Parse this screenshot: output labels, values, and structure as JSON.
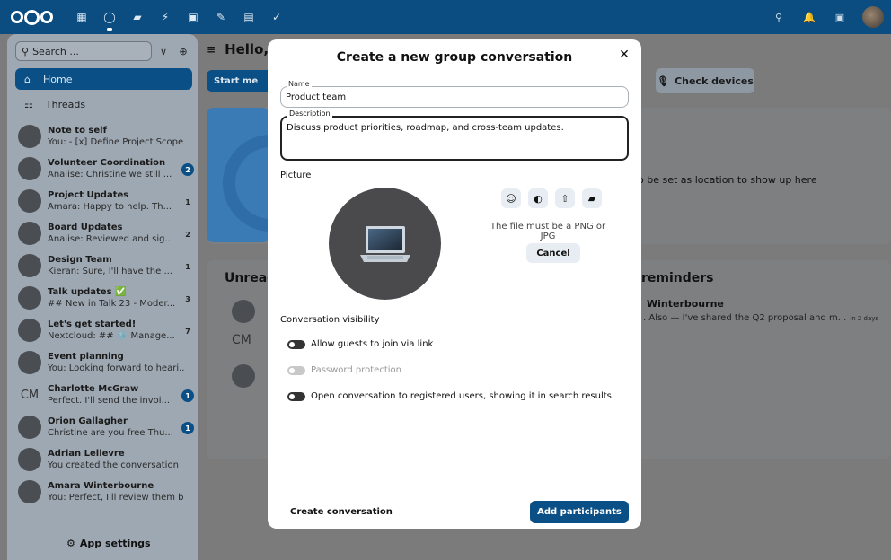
{
  "topbar": {
    "apps": [
      "dashboard-icon",
      "talk-icon",
      "files-icon",
      "activity-icon",
      "calendar-icon",
      "notes-icon",
      "deck-icon",
      "tasks-icon"
    ],
    "right": [
      "search-icon",
      "notifications-icon",
      "contacts-icon"
    ]
  },
  "sidebar": {
    "search_placeholder": "Search ...",
    "home_label": "Home",
    "threads_label": "Threads",
    "conversations": [
      {
        "name": "Note to self",
        "msg": "You: - [x] Define Project Scope ...",
        "badge": ""
      },
      {
        "name": "Volunteer Coordination",
        "msg": "Analise: Christine we still ...",
        "badge": "2",
        "badge_style": "blue"
      },
      {
        "name": "Project Updates",
        "msg": "Amara: Happy to help. Th...",
        "badge": "1",
        "badge_style": "plain"
      },
      {
        "name": "Board Updates",
        "msg": "Analise: Reviewed and sig...",
        "badge": "2",
        "badge_style": "plain"
      },
      {
        "name": "Design Team",
        "msg": "Kieran: Sure, I'll have the ...",
        "badge": "1",
        "badge_style": "plain"
      },
      {
        "name": "Talk updates ✅",
        "msg": "## New in Talk 23 - Moder...",
        "badge": "3",
        "badge_style": "plain"
      },
      {
        "name": "Let's get started!",
        "msg": "Nextcloud: ## ⚙️ Manage...",
        "badge": "7",
        "badge_style": "plain"
      },
      {
        "name": "Event planning",
        "msg": "You: Looking forward to heari...",
        "badge": ""
      },
      {
        "name": "Charlotte McGraw",
        "msg": "Perfect. I'll send the invoi...",
        "badge": "1",
        "badge_style": "blue",
        "initials": "CM"
      },
      {
        "name": "Orion Gallagher",
        "msg": "Christine are you free Thu...",
        "badge": "1",
        "badge_style": "blue"
      },
      {
        "name": "Adrian Lelievre",
        "msg": "You created the conversation",
        "badge": ""
      },
      {
        "name": "Amara Winterbourne",
        "msg": "You: Perfect, I'll review them b...",
        "badge": ""
      }
    ],
    "app_settings": "App settings"
  },
  "main": {
    "greeting": "Hello,",
    "start_meeting": "Start me",
    "check_devices": "Check devices",
    "location_note": "o be set as location to show up here",
    "unread_title": "Unread",
    "reminders_title": "reminders",
    "reminder_name": "Winterbourne",
    "reminder_msg": ". Also — I've shared the Q2 proposal and m...",
    "reminder_time": "in 2 days",
    "mini_initials": "CM"
  },
  "modal": {
    "title": "Create a new group conversation",
    "name_label": "Name",
    "name_value": "Product team",
    "desc_label": "Description",
    "desc_value": "Discuss product priorities, roadmap, and cross-team updates.",
    "picture_label": "Picture",
    "file_note": "The file must be a PNG or JPG",
    "cancel": "Cancel",
    "visibility_label": "Conversation visibility",
    "toggles": [
      {
        "label": "Allow guests to join via link",
        "enabled": false,
        "disabled": false
      },
      {
        "label": "Password protection",
        "enabled": false,
        "disabled": true
      },
      {
        "label": "Open conversation to registered users, showing it in search results",
        "enabled": false,
        "disabled": false
      }
    ],
    "create_label": "Create conversation",
    "add_participants": "Add participants"
  }
}
